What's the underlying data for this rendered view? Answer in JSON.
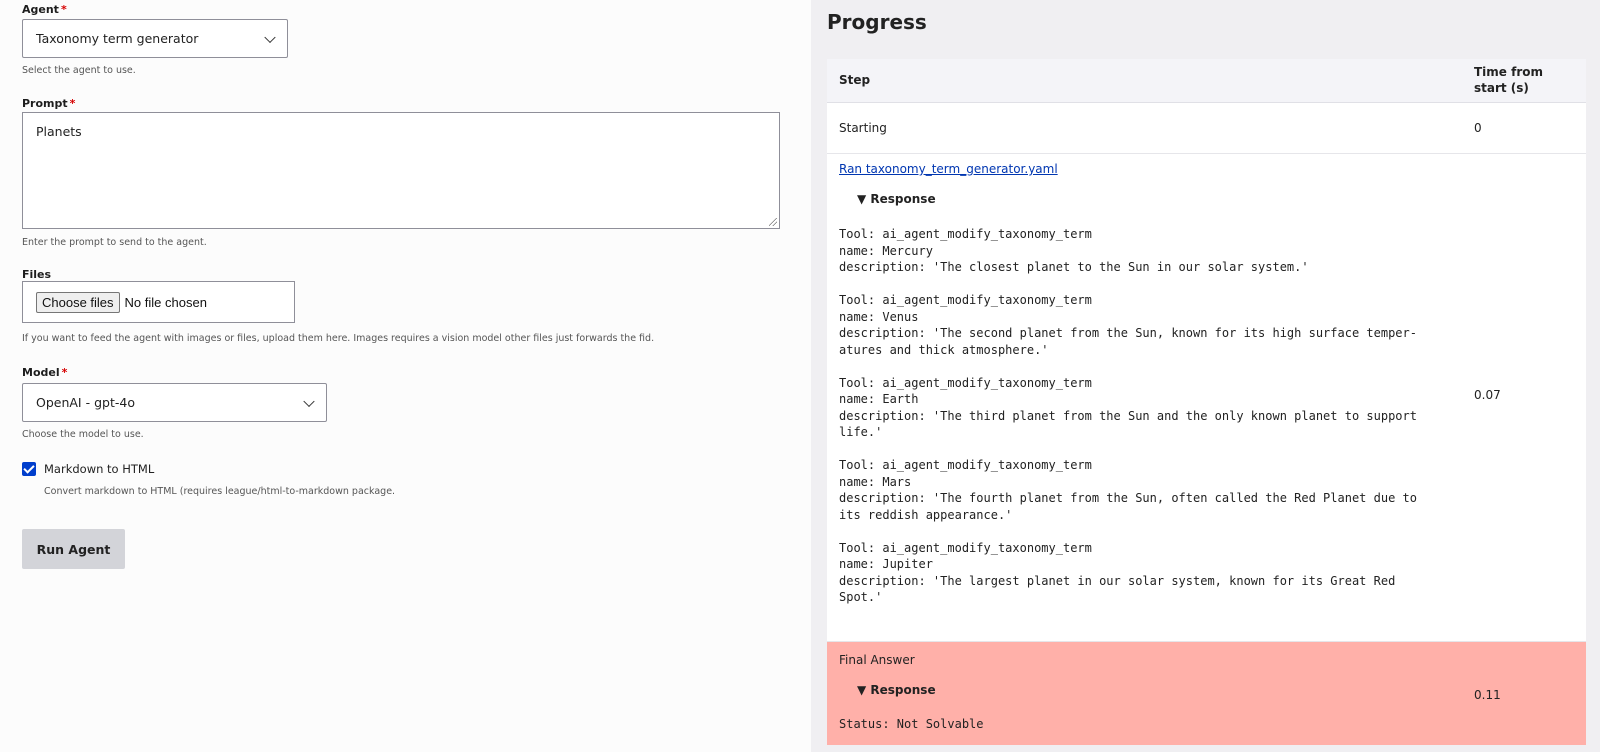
{
  "form": {
    "agent": {
      "label": "Agent",
      "required": "*",
      "value": "Taxonomy term generator",
      "help": "Select the agent to use."
    },
    "prompt": {
      "label": "Prompt",
      "required": "*",
      "value": "Planets",
      "help": "Enter the prompt to send to the agent."
    },
    "files": {
      "label": "Files",
      "button": "Choose files",
      "status": "No file chosen",
      "help": "If you want to feed the agent with images or files, upload them here. Images requires a vision model other files just forwards the fid."
    },
    "model": {
      "label": "Model",
      "required": "*",
      "value": "OpenAI - gpt-4o",
      "help": "Choose the model to use."
    },
    "markdown": {
      "checked": true,
      "label": "Markdown to HTML",
      "help": "Convert markdown to HTML (requires league/html-to-markdown package."
    },
    "run_button": "Run Agent"
  },
  "progress": {
    "title": "Progress",
    "columns": {
      "step": "Step",
      "time": "Time from start (s)"
    },
    "rows": [
      {
        "step": "Starting",
        "time": "0"
      },
      {
        "link": "Ran taxonomy_term_generator.yaml",
        "toggle": "▼ Response",
        "output": "Tool: ai_agent_modify_taxonomy_term\nname: Mercury\ndescription: 'The closest planet to the Sun in our solar system.'\n\nTool: ai_agent_modify_taxonomy_term\nname: Venus\ndescription: 'The second planet from the Sun, known for its high surface temper-\natures and thick atmosphere.'\n\nTool: ai_agent_modify_taxonomy_term\nname: Earth\ndescription: 'The third planet from the Sun and the only known planet to support\nlife.'\n\nTool: ai_agent_modify_taxonomy_term\nname: Mars\ndescription: 'The fourth planet from the Sun, often called the Red Planet due to\nits reddish appearance.'\n\nTool: ai_agent_modify_taxonomy_term\nname: Jupiter\ndescription: 'The largest planet in our solar system, known for its Great Red\nSpot.'",
        "time": "0.07"
      },
      {
        "step": "Final Answer",
        "toggle": "▼ Response",
        "output": "Status: Not Solvable",
        "time": "0.11",
        "highlight": "#ffb0a9"
      }
    ]
  }
}
